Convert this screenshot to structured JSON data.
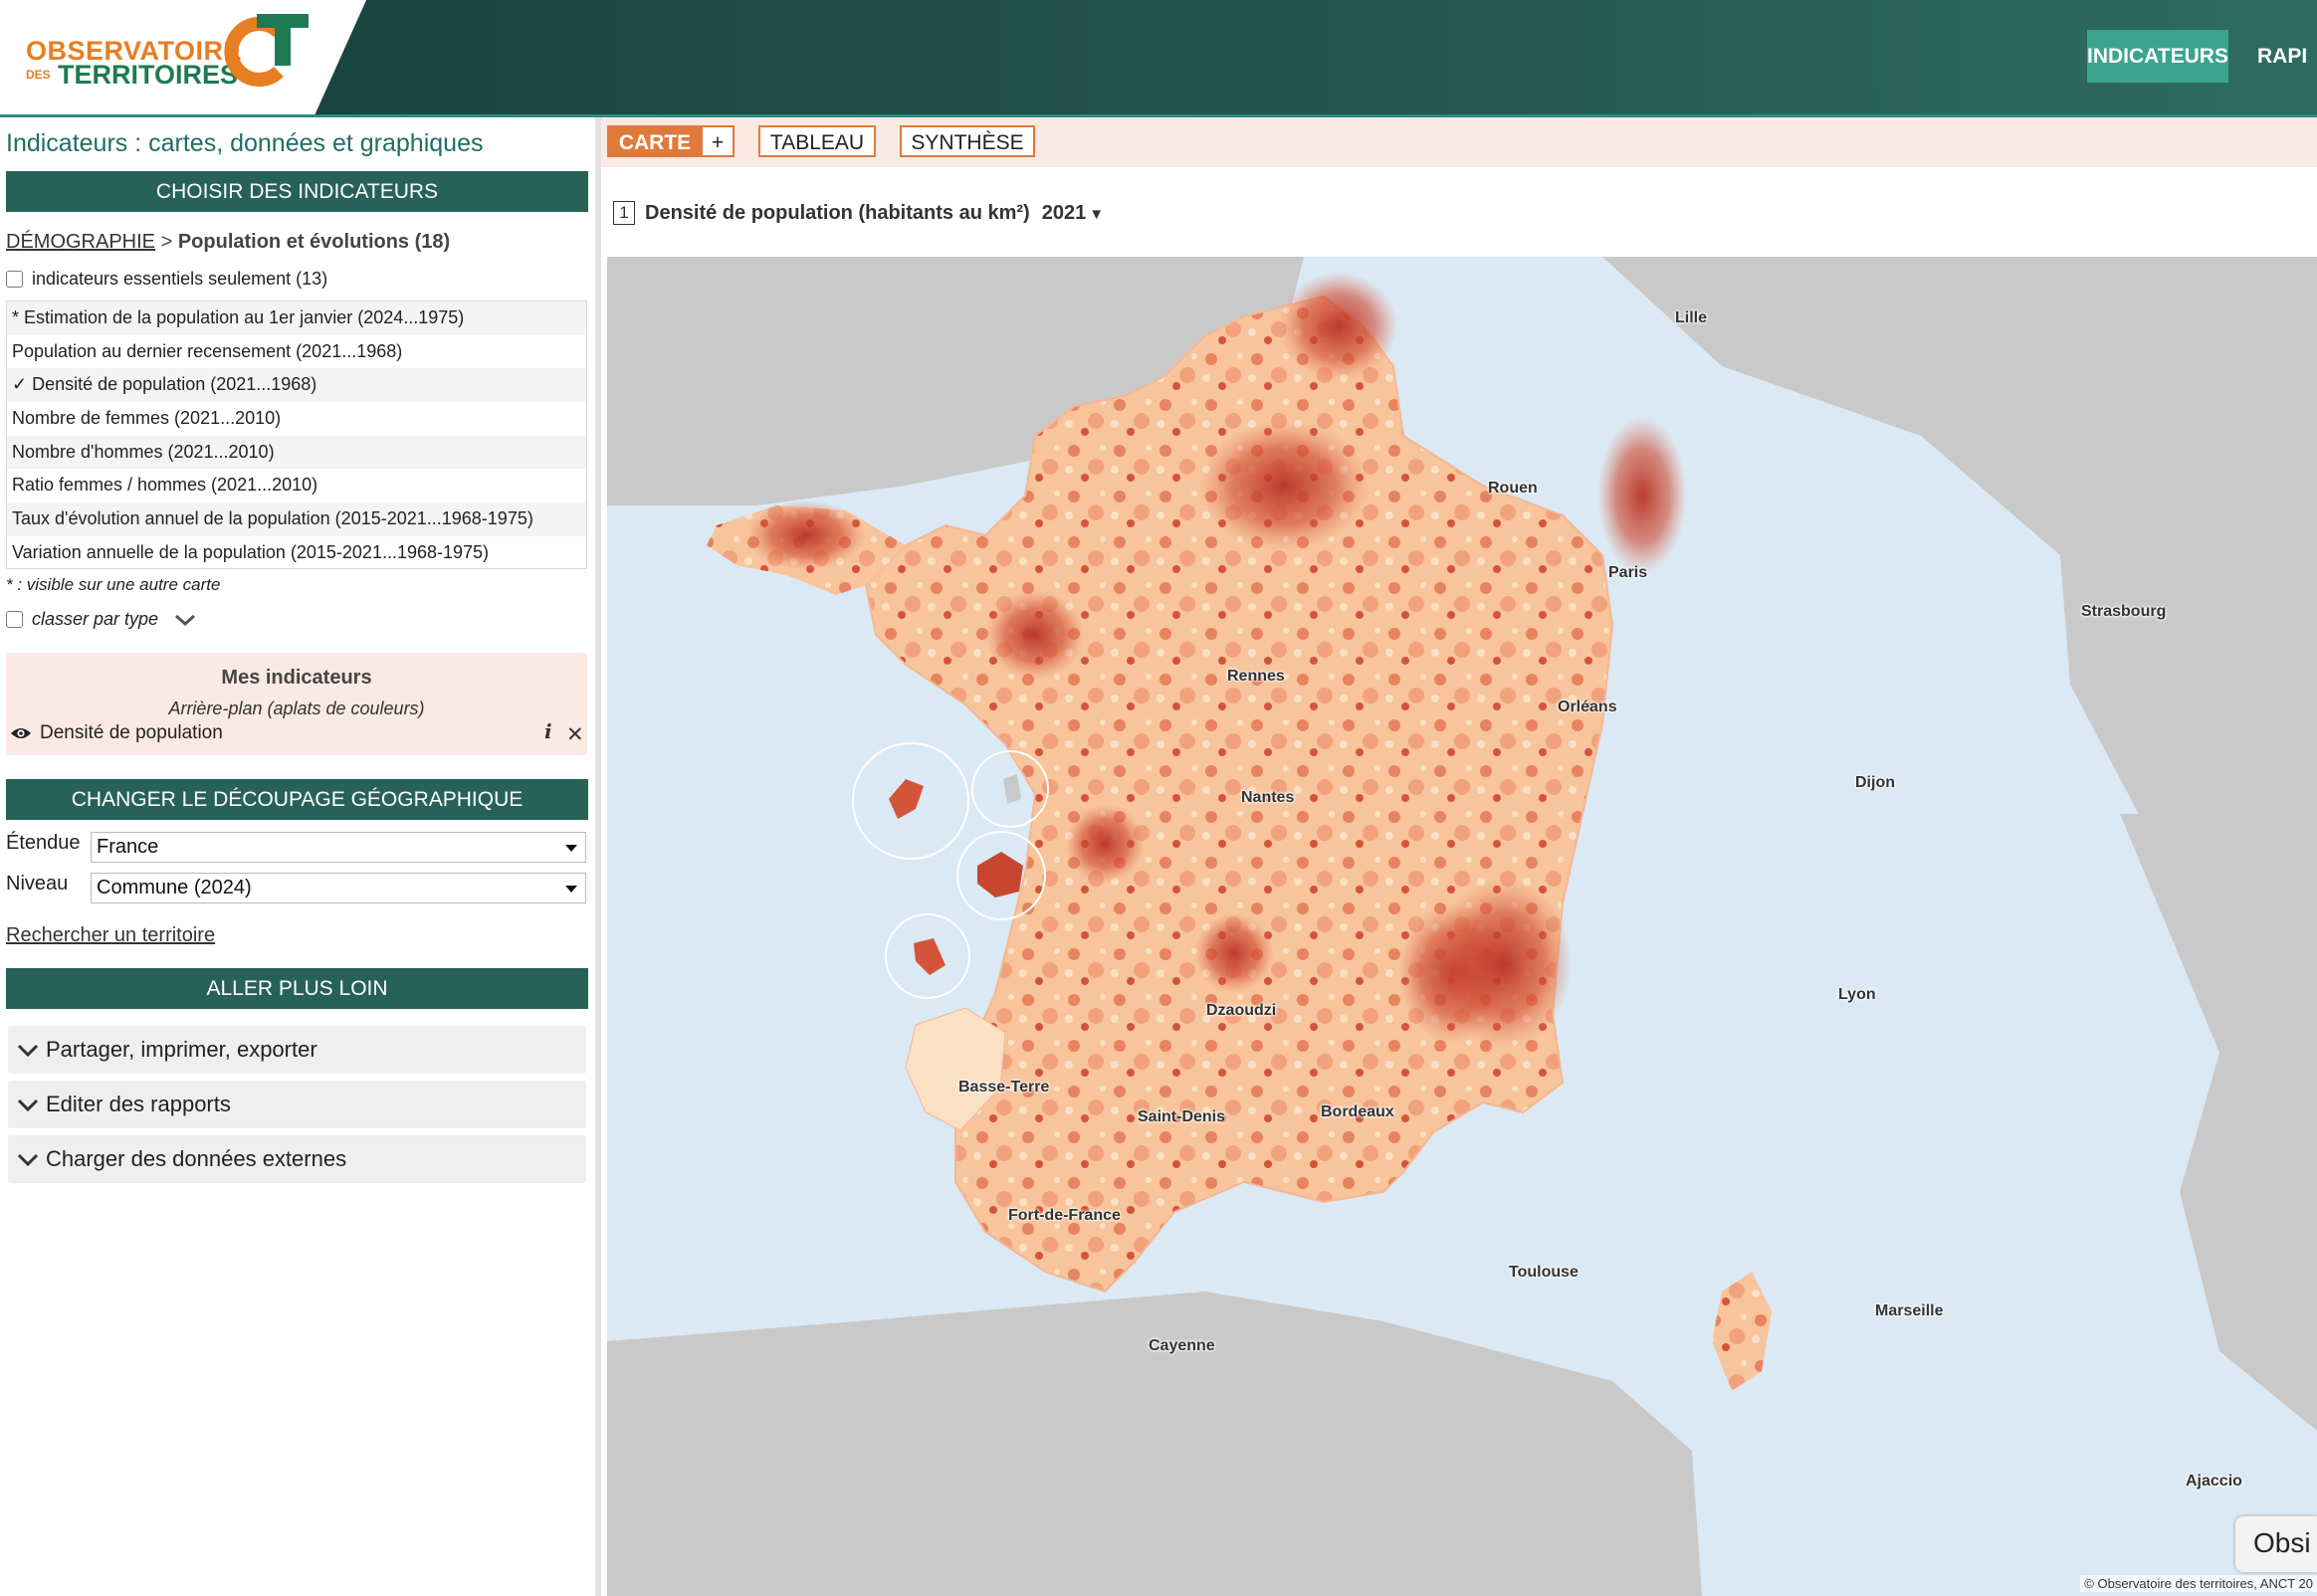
{
  "header": {
    "logo_line1": "OBSERVATOIRE",
    "logo_des": "DES",
    "logo_line2": "TERRITOIRES",
    "nav": [
      "INDICATEURS",
      "RAPI"
    ]
  },
  "sidebar": {
    "title": "Indicateurs : cartes, données et graphiques",
    "choose_bar": "CHOISIR DES INDICATEURS",
    "breadcrumb_link": "DÉMOGRAPHIE",
    "breadcrumb_sep": " > ",
    "breadcrumb_current": "Population et évolutions (18)",
    "essentials_label": "indicateurs essentiels seulement (13)",
    "indicators": [
      "* Estimation de la population au 1er janvier (2024...1975)",
      "Population au dernier recensement (2021...1968)",
      "✓ Densité de population (2021...1968)",
      "Nombre de femmes (2021...2010)",
      "Nombre d'hommes (2021...2010)",
      "Ratio femmes / hommes (2021...2010)",
      "Taux d'évolution annuel de la population (2015-2021...1968-1975)",
      "Variation annuelle de la population (2015-2021...1968-1975)"
    ],
    "note": "* : visible sur une autre carte",
    "classer_label": "classer par type",
    "mes": {
      "title": "Mes indicateurs",
      "subtitle": "Arrière-plan (aplats de couleurs)",
      "item": "Densité de population"
    },
    "geo_bar": "CHANGER LE DÉCOUPAGE GÉOGRAPHIQUE",
    "etendue_label": "Étendue",
    "etendue_value": "France",
    "niveau_label": "Niveau",
    "niveau_value": "Commune (2024)",
    "search_link": "Rechercher un territoire",
    "plus_bar": "ALLER PLUS LOIN",
    "accordions": [
      "Partager, imprimer, exporter",
      "Editer des rapports",
      "Charger des données externes"
    ]
  },
  "main": {
    "tabs": {
      "carte": "CARTE",
      "plus": "+",
      "tableau": "TABLEAU",
      "synthese": "SYNTHÈSE"
    },
    "map_number": "1",
    "map_title": "Densité de population (habitants au km²)",
    "map_year": "2021",
    "cities": [
      "Lille",
      "Rouen",
      "Paris",
      "Strasbourg",
      "Rennes",
      "Orléans",
      "Nantes",
      "Dijon",
      "Lyon",
      "Bordeaux",
      "Toulouse",
      "Marseille",
      "Ajaccio",
      "Dzaoudzi",
      "Basse-Terre",
      "Saint-Denis",
      "Fort-de-France",
      "Cayenne"
    ],
    "copyright": "© Observatoire des territoires, ANCT 20",
    "obsi_label": "Obsi"
  },
  "colors": {
    "header_dark": "#173f3c",
    "green_bar": "#27625a",
    "accent_orange": "#e07a3a",
    "sea": "#dbe9f4",
    "density_low": "#fbd9b0",
    "density_high": "#c6402c"
  }
}
